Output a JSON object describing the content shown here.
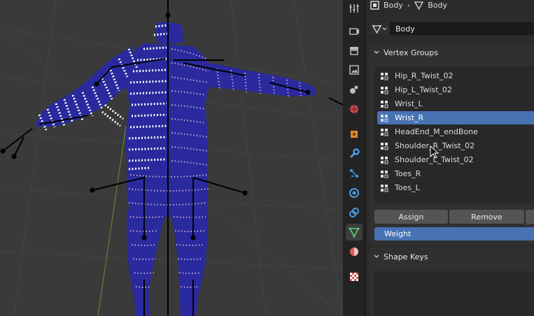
{
  "breadcrumb": {
    "object": "Body",
    "mesh": "Body"
  },
  "mesh_datablock": {
    "name": "Body"
  },
  "tabs": [
    {
      "icon": "tool-icon"
    },
    {
      "icon": "render-icon"
    },
    {
      "icon": "output-icon"
    },
    {
      "icon": "view-layer-icon"
    },
    {
      "icon": "scene-icon"
    },
    {
      "icon": "world-icon"
    },
    {
      "icon": "object-icon"
    },
    {
      "icon": "modifier-icon"
    },
    {
      "icon": "particles-icon"
    },
    {
      "icon": "physics-icon"
    },
    {
      "icon": "constraints-icon"
    },
    {
      "icon": "mesh-data-icon",
      "active": true
    },
    {
      "icon": "material-icon"
    },
    {
      "icon": "texture-icon"
    }
  ],
  "vertex_groups": {
    "title": "Vertex Groups",
    "items": [
      "Hip_R_Twist_02",
      "Hip_L_Twist_02",
      "Wrist_L",
      "Wrist_R",
      "HeadEnd_M_endBone",
      "Shoulder_R_Twist_02",
      "Shoulder_L_Twist_02",
      "Toes_R",
      "Toes_L"
    ],
    "selected_index": 3,
    "assign_label": "Assign",
    "remove_label": "Remove",
    "weight_label": "Weight"
  },
  "shape_keys": {
    "title": "Shape Keys"
  },
  "colors": {
    "accent": "#4772b3",
    "mesh": "#2a2a9e",
    "selected_vertices": "#ffffff",
    "unselected_vertices": "#c9a8c9",
    "viewport_bg": "#3a3a3a"
  }
}
